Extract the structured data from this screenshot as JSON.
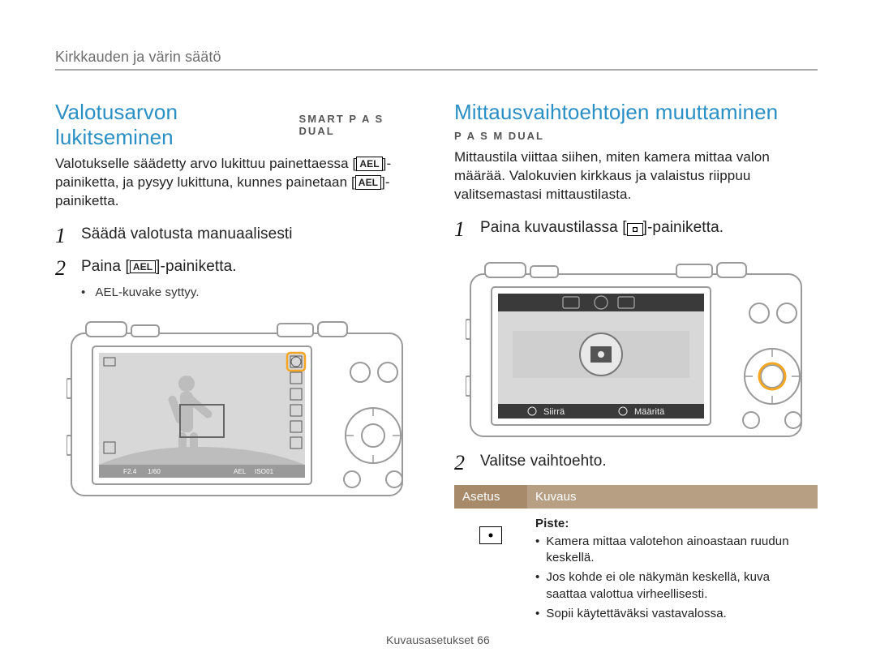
{
  "section_label": "Kirkkauden ja värin säätö",
  "left": {
    "heading": "Valotusarvon lukitseminen",
    "modes": "SMART  P  A  S  DUAL",
    "intro_pre": "Valotukselle säädetty arvo lukittuu painettaessa [",
    "ael_label": "AEL",
    "intro_mid": "]-painiketta, ja pysyy lukittuna, kunnes painetaan [",
    "intro_post": "]-painiketta.",
    "step1": "Säädä valotusta manuaalisesti",
    "step2_pre": "Paina [",
    "step2_post": "]-painiketta.",
    "bullet_pre": "",
    "bullet_ael": "AEL",
    "bullet_post": "-kuvake syttyy.",
    "screen": {
      "f": "F2.4",
      "shutter": "1/60",
      "iso": "ISO01",
      "ael_tag": "AEL"
    }
  },
  "right": {
    "heading": "Mittausvaihtoehtojen muuttaminen",
    "modes": "P  A  S  M  DUAL",
    "intro": "Mittaustila viittaa siihen, miten kamera mittaa valon määrää. Valokuvien kirkkaus ja valaistus riippuu valitsemastasi mittaustilasta.",
    "step1_pre": "Paina kuvaustilassa [",
    "step1_post": "]-painiketta.",
    "screen": {
      "move": "Siirrä",
      "set": "Määritä"
    },
    "step2": "Valitse vaihtoehto.",
    "table": {
      "h1": "Asetus",
      "h2": "Kuvaus",
      "row_title": "Piste:",
      "b1": "Kamera mittaa valotehon ainoastaan ruudun keskellä.",
      "b2": "Jos kohde ei ole näkymän keskellä, kuva saattaa valottua virheellisesti.",
      "b3": "Sopii käytettäväksi vastavalossa."
    }
  },
  "footer": "Kuvausasetukset  66"
}
